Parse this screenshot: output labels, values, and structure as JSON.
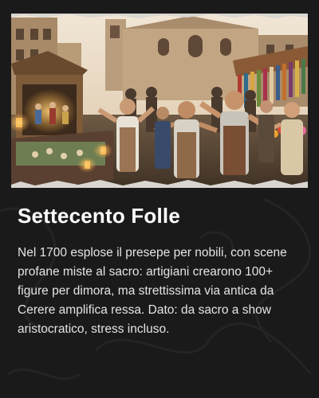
{
  "card": {
    "image": {
      "subject": "crowded-nativity-market-scene",
      "alt_icon": "photo-illustration"
    },
    "title": "Settecento Folle",
    "body": "Nel 1700 esplose il presepe per nobili, con scene profane miste al sacro: artigiani crearono 100+ figure per dimora, ma strettissima via antica da Cerere amplifica ressa. Dato: da sacro a show aristocratico, stress incluso."
  },
  "colors": {
    "background": "#1a1a1b",
    "title": "#ffffff",
    "body_text": "#e4e4e4",
    "torn_edge": "#d9d6d0"
  }
}
